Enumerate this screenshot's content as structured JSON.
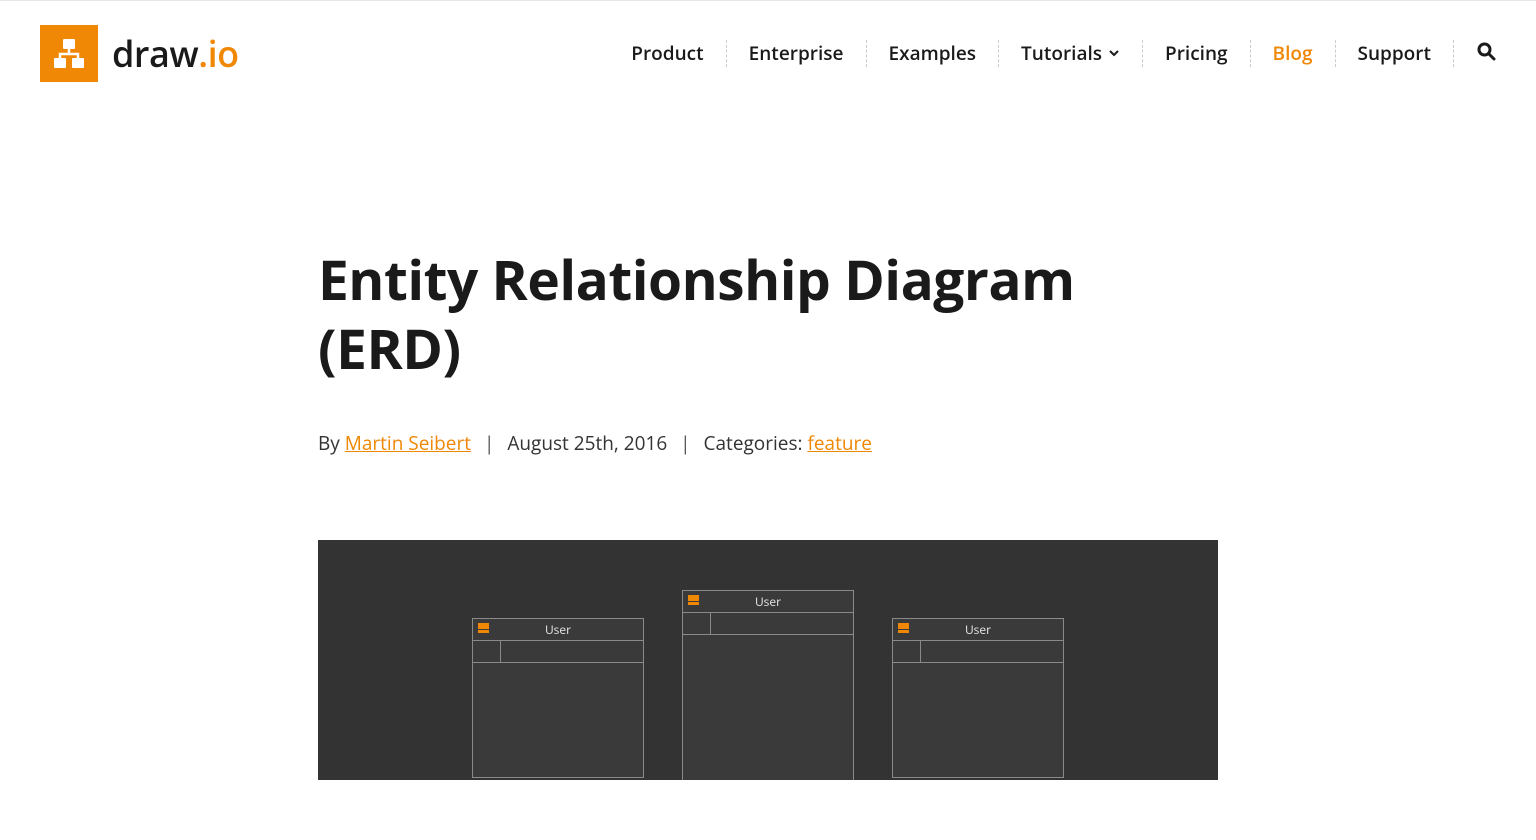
{
  "brand": {
    "name_a": "draw",
    "name_b": ".io"
  },
  "nav": {
    "items": [
      {
        "label": "Product",
        "active": false
      },
      {
        "label": "Enterprise",
        "active": false
      },
      {
        "label": "Examples",
        "active": false
      },
      {
        "label": "Tutorials",
        "active": false,
        "dropdown": true
      },
      {
        "label": "Pricing",
        "active": false
      },
      {
        "label": "Blog",
        "active": true
      },
      {
        "label": "Support",
        "active": false
      }
    ]
  },
  "article": {
    "title": "Entity Relationship Diagram (ERD)",
    "byline_prefix": "By ",
    "author": "Martin Seibert",
    "date": "August 25th, 2016",
    "categories_label": "Categories: ",
    "category": "feature"
  },
  "hero": {
    "entities": [
      "User",
      "User",
      "User"
    ]
  },
  "colors": {
    "accent": "#f08705"
  }
}
